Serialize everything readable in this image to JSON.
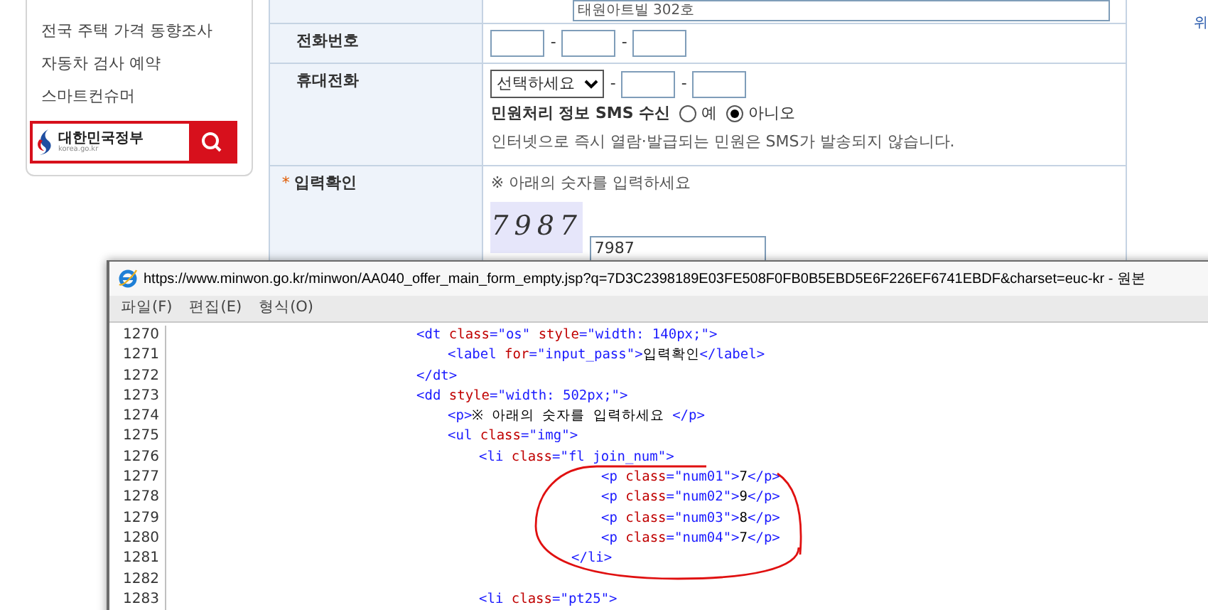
{
  "sidebar": {
    "items": [
      "전국 주택 가격 동향조사",
      "자동차 검사 예약",
      "스마트컨슈머"
    ],
    "gov_logo": {
      "name": "대한민국정부",
      "site": "korea.go.kr"
    }
  },
  "form": {
    "address_value": "태원아트빌 302호",
    "phone": {
      "label": "전화번호",
      "separators": [
        "-",
        "-"
      ]
    },
    "mobile": {
      "label": "휴대전화",
      "select": "선택하세요",
      "separators": [
        "-",
        "-"
      ],
      "sms_label": "민원처리 정보 SMS 수신",
      "options": [
        {
          "label": "예",
          "selected": false
        },
        {
          "label": "아니오",
          "selected": true
        }
      ],
      "note": "인터넷으로 즉시 열람·발급되는 민원은 SMS가 발송되지 않습니다."
    },
    "captcha": {
      "label": "입력확인",
      "required_mark": "*",
      "instruction": "※ 아래의 숫자를 입력하세요",
      "image_text": "7987",
      "value": "7987"
    }
  },
  "right_edge_text": "위",
  "source_window": {
    "title": "https://www.minwon.go.kr/minwon/AA040_offer_main_form_empty.jsp?q=7D3C2398189E03FE508F0FB0B5EBD5E6F226EF6741EBDF&charset=euc-kr - 원본",
    "menu": [
      "파일(F)",
      "편집(E)",
      "형식(O)"
    ],
    "lines": [
      {
        "number": "1270",
        "segments": [
          {
            "kind": "tag",
            "text": "<dt "
          },
          {
            "kind": "attr",
            "text": "class"
          },
          {
            "kind": "tag",
            "text": "=\"os\" "
          },
          {
            "kind": "attr",
            "text": "style"
          },
          {
            "kind": "tag",
            "text": "=\"width: 140px;\">"
          }
        ]
      },
      {
        "number": "1271",
        "segments": [
          {
            "kind": "tag",
            "text": "<label "
          },
          {
            "kind": "attr",
            "text": "for"
          },
          {
            "kind": "tag",
            "text": "=\"input_pass\">"
          },
          {
            "kind": "text",
            "text": "입력확인"
          },
          {
            "kind": "tag",
            "text": "</label>"
          }
        ]
      },
      {
        "number": "1272",
        "segments": [
          {
            "kind": "tag",
            "text": "</dt>"
          }
        ]
      },
      {
        "number": "1273",
        "segments": [
          {
            "kind": "tag",
            "text": "<dd "
          },
          {
            "kind": "attr",
            "text": "style"
          },
          {
            "kind": "tag",
            "text": "=\"width: 502px;\">"
          }
        ]
      },
      {
        "number": "1274",
        "segments": [
          {
            "kind": "tag",
            "text": "<p>"
          },
          {
            "kind": "text",
            "text": "※ 아래의 숫자를 입력하세요 "
          },
          {
            "kind": "tag",
            "text": "</p>"
          }
        ]
      },
      {
        "number": "1275",
        "segments": [
          {
            "kind": "tag",
            "text": "<ul "
          },
          {
            "kind": "attr",
            "text": "class"
          },
          {
            "kind": "tag",
            "text": "=\"img\">"
          }
        ]
      },
      {
        "number": "1276",
        "segments": [
          {
            "kind": "tag",
            "text": "<li "
          },
          {
            "kind": "attr",
            "text": "class"
          },
          {
            "kind": "tag",
            "text": "=\"fl join_num\">"
          }
        ]
      },
      {
        "number": "1277",
        "segments": [
          {
            "kind": "tag",
            "text": "<p "
          },
          {
            "kind": "attr",
            "text": "class"
          },
          {
            "kind": "tag",
            "text": "=\"num01\">"
          },
          {
            "kind": "text",
            "text": "7"
          },
          {
            "kind": "tag",
            "text": "</p>"
          }
        ]
      },
      {
        "number": "1278",
        "segments": [
          {
            "kind": "tag",
            "text": "<p "
          },
          {
            "kind": "attr",
            "text": "class"
          },
          {
            "kind": "tag",
            "text": "=\"num02\">"
          },
          {
            "kind": "text",
            "text": "9"
          },
          {
            "kind": "tag",
            "text": "</p>"
          }
        ]
      },
      {
        "number": "1279",
        "segments": [
          {
            "kind": "tag",
            "text": "<p "
          },
          {
            "kind": "attr",
            "text": "class"
          },
          {
            "kind": "tag",
            "text": "=\"num03\">"
          },
          {
            "kind": "text",
            "text": "8"
          },
          {
            "kind": "tag",
            "text": "</p>"
          }
        ]
      },
      {
        "number": "1280",
        "segments": [
          {
            "kind": "tag",
            "text": "<p "
          },
          {
            "kind": "attr",
            "text": "class"
          },
          {
            "kind": "tag",
            "text": "=\"num04\">"
          },
          {
            "kind": "text",
            "text": "7"
          },
          {
            "kind": "tag",
            "text": "</p>"
          }
        ]
      },
      {
        "number": "1281",
        "segments": [
          {
            "kind": "tag",
            "text": "</li>"
          }
        ]
      },
      {
        "number": "1282"
      },
      {
        "number": "1283",
        "segments": [
          {
            "kind": "tag",
            "text": "<li "
          },
          {
            "kind": "attr",
            "text": "class"
          },
          {
            "kind": "tag",
            "text": "=\"pt25\">"
          }
        ]
      }
    ]
  }
}
